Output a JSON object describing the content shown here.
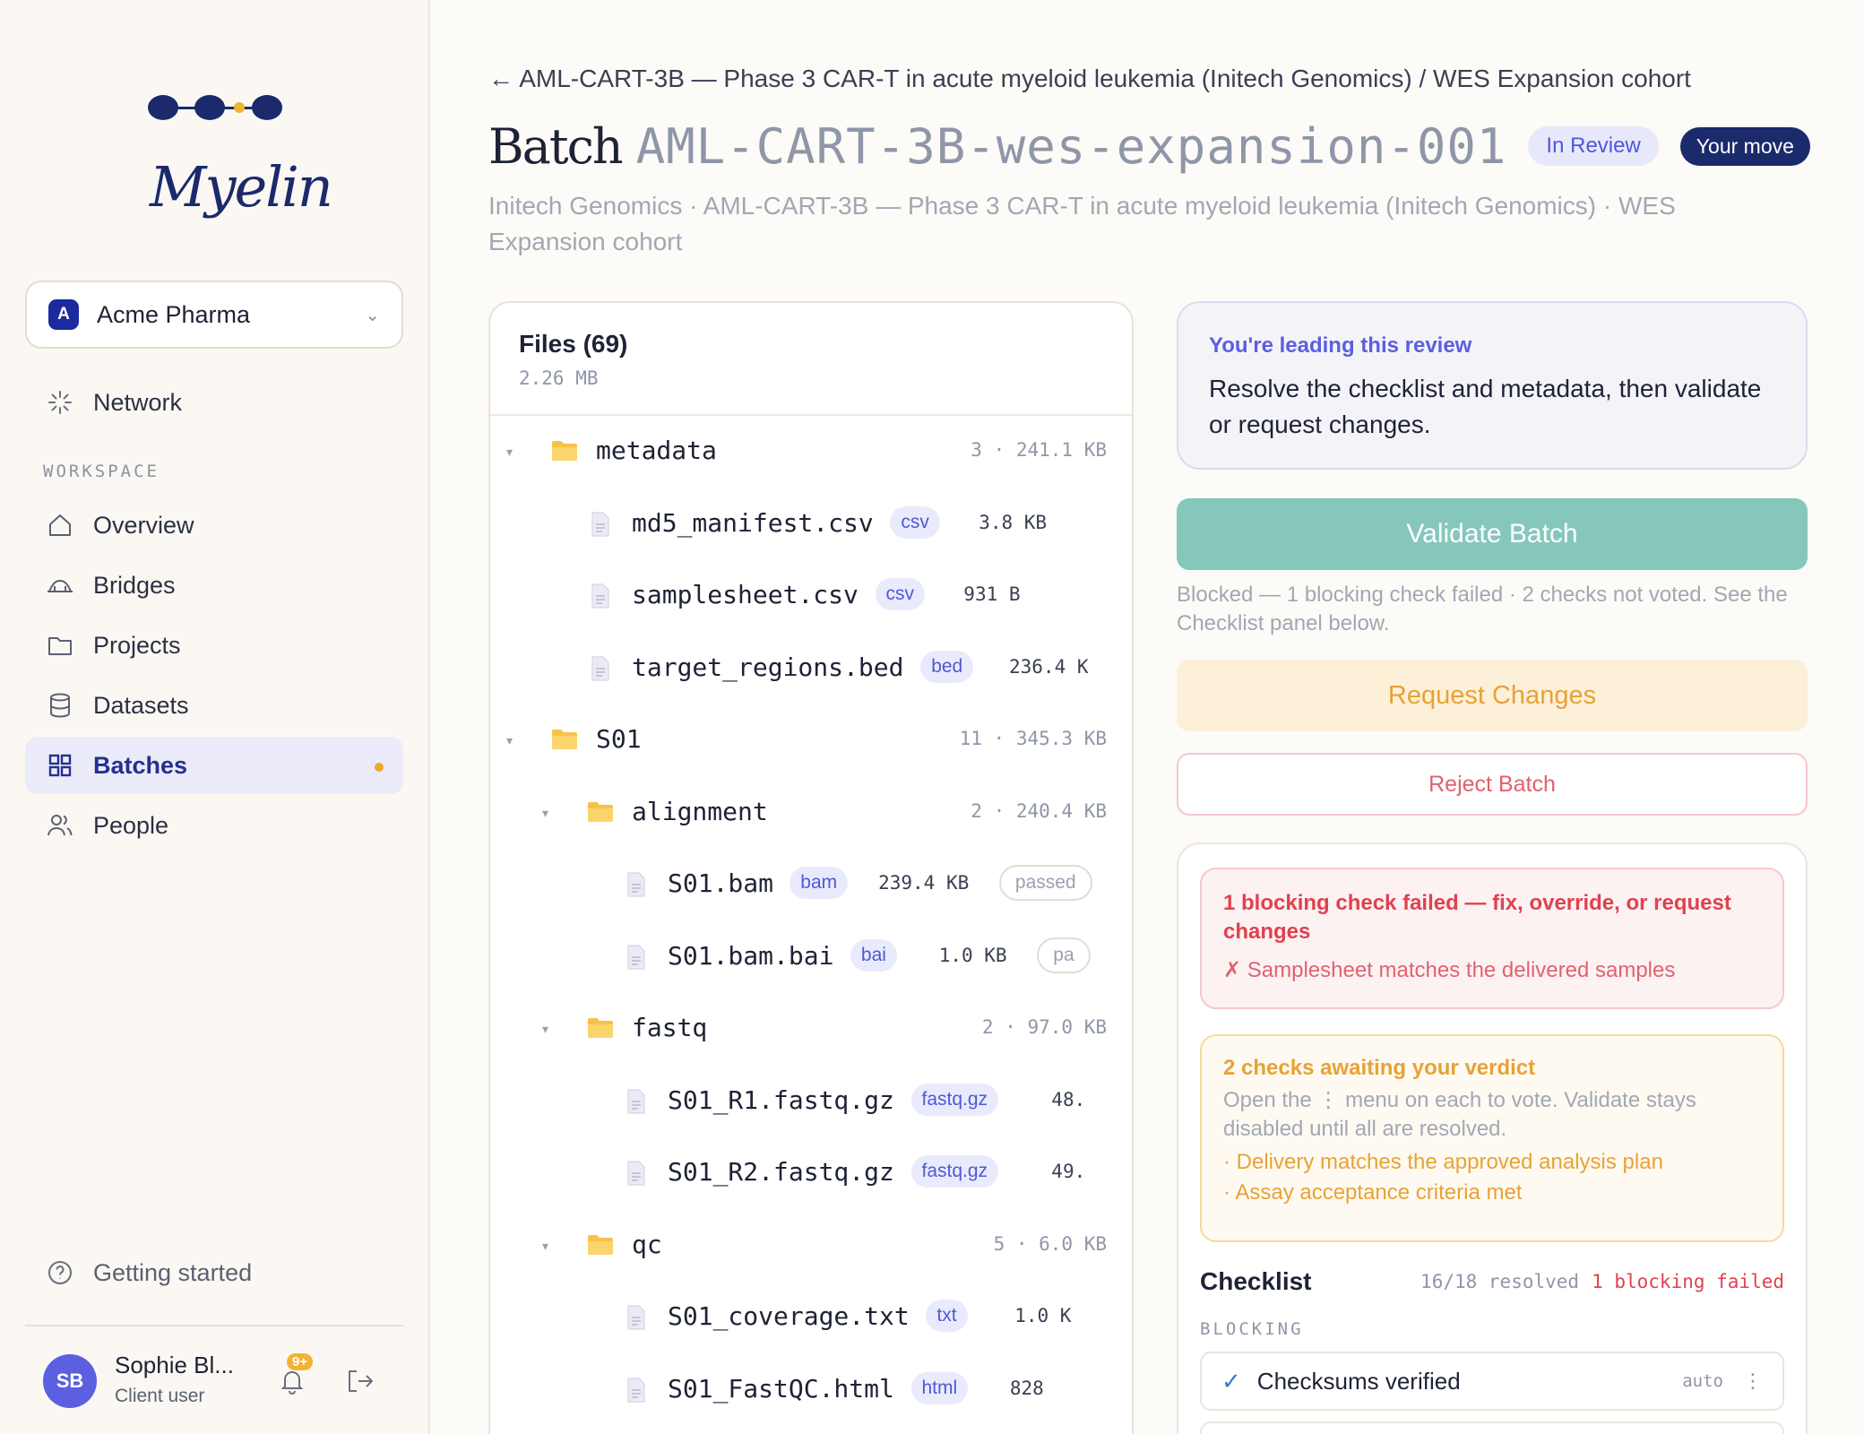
{
  "brand": {
    "name": "Myelin"
  },
  "org": {
    "badge": "A",
    "name": "Acme Pharma"
  },
  "nav": {
    "network": "Network",
    "section_label": "WORKSPACE",
    "items": [
      {
        "label": "Overview",
        "icon": "home-icon"
      },
      {
        "label": "Bridges",
        "icon": "bridge-icon"
      },
      {
        "label": "Projects",
        "icon": "folder-icon"
      },
      {
        "label": "Datasets",
        "icon": "database-icon"
      },
      {
        "label": "Batches",
        "icon": "grid-icon",
        "active": true
      },
      {
        "label": "People",
        "icon": "people-icon"
      }
    ],
    "getting_started": "Getting started"
  },
  "user": {
    "initials": "SB",
    "name": "Sophie Bl...",
    "role": "Client user",
    "notifications": "9+"
  },
  "header": {
    "breadcrumb": "← AML-CART-3B — Phase 3 CAR-T in acute myeloid leukemia (Initech Genomics) / WES Expansion cohort",
    "title_prefix": "Batch",
    "batch_id": "AML-CART-3B-wes-expansion-001",
    "status": "In Review",
    "turn": "Your move",
    "subtitle": "Initech Genomics · AML-CART-3B — Phase 3 CAR-T in acute myeloid leukemia (Initech Genomics) · WES Expansion cohort"
  },
  "files": {
    "title": "Files (69)",
    "total_size": "2.26 MB",
    "rows": [
      {
        "type": "folder",
        "depth": 0,
        "name": "metadata",
        "meta": "3 · 241.1 KB"
      },
      {
        "type": "file",
        "depth": 1,
        "name": "md5_manifest.csv",
        "tag": "csv",
        "size": "3.8 KB"
      },
      {
        "type": "file",
        "depth": 1,
        "name": "samplesheet.csv",
        "tag": "csv",
        "size": "931 B"
      },
      {
        "type": "file",
        "depth": 1,
        "name": "target_regions.bed",
        "tag": "bed",
        "size": "236.4 K"
      },
      {
        "type": "folder",
        "depth": 0,
        "name": "S01",
        "meta": "11 · 345.3 KB"
      },
      {
        "type": "folder",
        "depth": 1,
        "name": "alignment",
        "meta": "2 · 240.4 KB"
      },
      {
        "type": "file",
        "depth": 2,
        "name": "S01.bam",
        "tag": "bam",
        "size": "239.4 KB",
        "status": "passed"
      },
      {
        "type": "file",
        "depth": 2,
        "name": "S01.bam.bai",
        "tag": "bai",
        "size": "1.0 KB",
        "status": "pa"
      },
      {
        "type": "folder",
        "depth": 1,
        "name": "fastq",
        "meta": "2 · 97.0 KB"
      },
      {
        "type": "file",
        "depth": 2,
        "name": "S01_R1.fastq.gz",
        "tag": "fastq.gz",
        "size": "48."
      },
      {
        "type": "file",
        "depth": 2,
        "name": "S01_R2.fastq.gz",
        "tag": "fastq.gz",
        "size": "49."
      },
      {
        "type": "folder",
        "depth": 1,
        "name": "qc",
        "meta": "5 · 6.0 KB"
      },
      {
        "type": "file",
        "depth": 2,
        "name": "S01_coverage.txt",
        "tag": "txt",
        "size": "1.0 K"
      },
      {
        "type": "file",
        "depth": 2,
        "name": "S01_FastQC.html",
        "tag": "html",
        "size": "828"
      }
    ]
  },
  "review": {
    "lead_title": "You're leading this review",
    "lead_body": "Resolve the checklist and metadata, then validate or request changes.",
    "validate": "Validate Batch",
    "blocked_note": "Blocked — 1 blocking check failed · 2 checks not voted. See the Checklist panel below.",
    "request_changes": "Request Changes",
    "reject": "Reject Batch",
    "fail_title": "1 blocking check failed — fix, override, or request changes",
    "fail_item": "✗  Samplesheet matches the delivered samples",
    "warn_title": "2 checks awaiting your verdict",
    "warn_body": "Open the ⋮ menu on each to vote. Validate stays disabled until all are resolved.",
    "warn_items": [
      "·  Delivery matches the approved analysis plan",
      "·  Assay acceptance criteria met"
    ],
    "checklist_title": "Checklist",
    "checklist_resolved": "16/18 resolved",
    "checklist_failed": "1 blocking failed",
    "checklist_section": "BLOCKING",
    "checklist_item": "Checksums verified",
    "checklist_item_mode": "auto"
  },
  "colors": {
    "accent": "#1b2a6b",
    "validate": "#86c7bc",
    "warn": "#e8a234",
    "danger": "#e0414f"
  }
}
